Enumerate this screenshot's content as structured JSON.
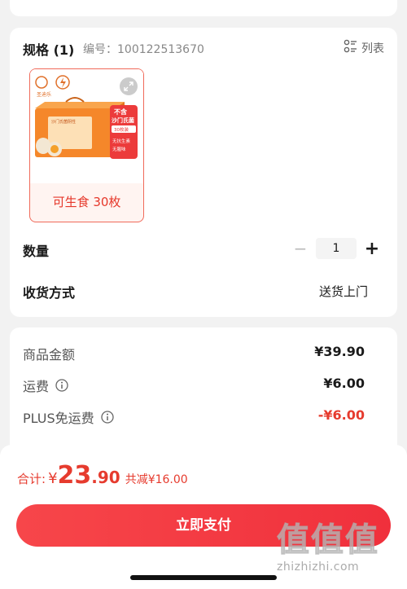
{
  "spec": {
    "title": "规格 (1)",
    "code": "编号：100122513670",
    "list_label": "列表",
    "sku": {
      "name": "可生食 30枚",
      "image": {
        "brand": "圣迪乐",
        "box_title": "沙门氏菌阴性",
        "badge_line1": "不含",
        "badge_line2": "沙门氏菌",
        "badge_count": "30枚装",
        "badge_line3": "无抗生素",
        "badge_line4": "无腥味"
      }
    },
    "quantity_label": "数量",
    "quantity_minus": "−",
    "quantity_value": "1",
    "quantity_plus": "+",
    "shipping_label": "收货方式",
    "shipping_value": "送货上门"
  },
  "prices": {
    "goods_label": "商品金额",
    "goods_value": "¥39.90",
    "freight_label": "运费",
    "freight_value": "¥6.00",
    "plus_label": "PLUS免运费",
    "plus_value": "-¥6.00"
  },
  "bottom": {
    "total_label": "合计:",
    "total_currency": "¥",
    "total_int": "23",
    "total_dec": ".90",
    "total_saved": "共减¥16.00",
    "pay_label": "立即支付"
  },
  "watermark": {
    "chars": [
      "值",
      "值",
      "值"
    ],
    "url": "zhizhizhi.com"
  },
  "colors": {
    "accent": "#e63b2e",
    "pay_button": "#f0303c",
    "page_bg": "#f2f2f2"
  }
}
